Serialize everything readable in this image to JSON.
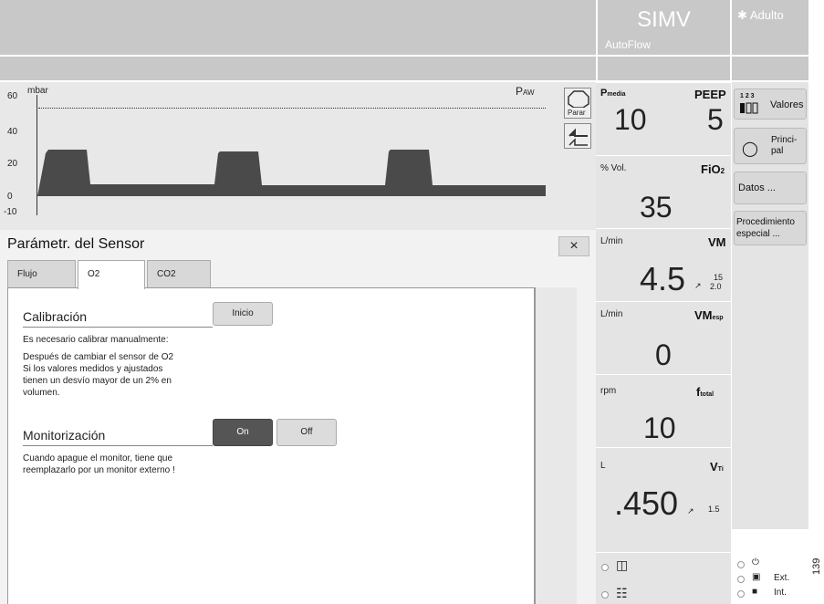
{
  "header": {
    "mode": "SIMV",
    "mode_sub": "AutoFlow",
    "patient": "Adulto"
  },
  "waveform": {
    "unit": "mbar",
    "label": "P",
    "label_sub": "AW",
    "ticks": [
      "60",
      "40",
      "20",
      "0",
      "-10"
    ]
  },
  "side_icons": {
    "stop_label": "Parar"
  },
  "params": [
    {
      "unit": "",
      "name": "P",
      "name_sub": "media",
      "value": "10"
    },
    {
      "unit": "",
      "name": "PEEP",
      "value": "5"
    },
    {
      "unit": "% Vol.",
      "name": "FiO",
      "name_sub": "2",
      "value": "35"
    },
    {
      "unit": "L/min",
      "name": "VM",
      "value": "4.5",
      "limits_hi": "15",
      "limits_lo": "2.0"
    },
    {
      "unit": "L/min",
      "name": "VM",
      "name_sub": "esp",
      "value": "0"
    },
    {
      "unit": "rpm",
      "name": "f",
      "name_sub": "total",
      "value": "10"
    },
    {
      "unit": "L",
      "name": "V",
      "name_sub": "Ti",
      "value": ".450",
      "limit": "1.5"
    }
  ],
  "right_buttons": {
    "valores": "Valores",
    "valores_digits": "1 2 3",
    "principal": "Princi- pal",
    "datos": "Datos ...",
    "procedimiento": "Procedimiento especial ..."
  },
  "dialog": {
    "title": "Parámetr. del Sensor",
    "close": "×",
    "tabs": [
      "Flujo",
      "O2",
      "CO2"
    ],
    "calibration": {
      "title": "Calibración",
      "button": "Inicio",
      "text": [
        "Es necesario calibrar manualmente:",
        "Después de cambiar el sensor de O2",
        "Si los valores medidos y ajustados",
        "tienen un desvío mayor de un 2% en",
        "volumen."
      ]
    },
    "monitoring": {
      "title": "Monitorización",
      "on": "On",
      "off": "Off",
      "text": [
        "Cuando apague el monitor, tiene que",
        "reemplazarlo por un monitor externo !"
      ]
    }
  },
  "status": {
    "ext": "Ext.",
    "int": "Int.",
    "code": "139"
  }
}
